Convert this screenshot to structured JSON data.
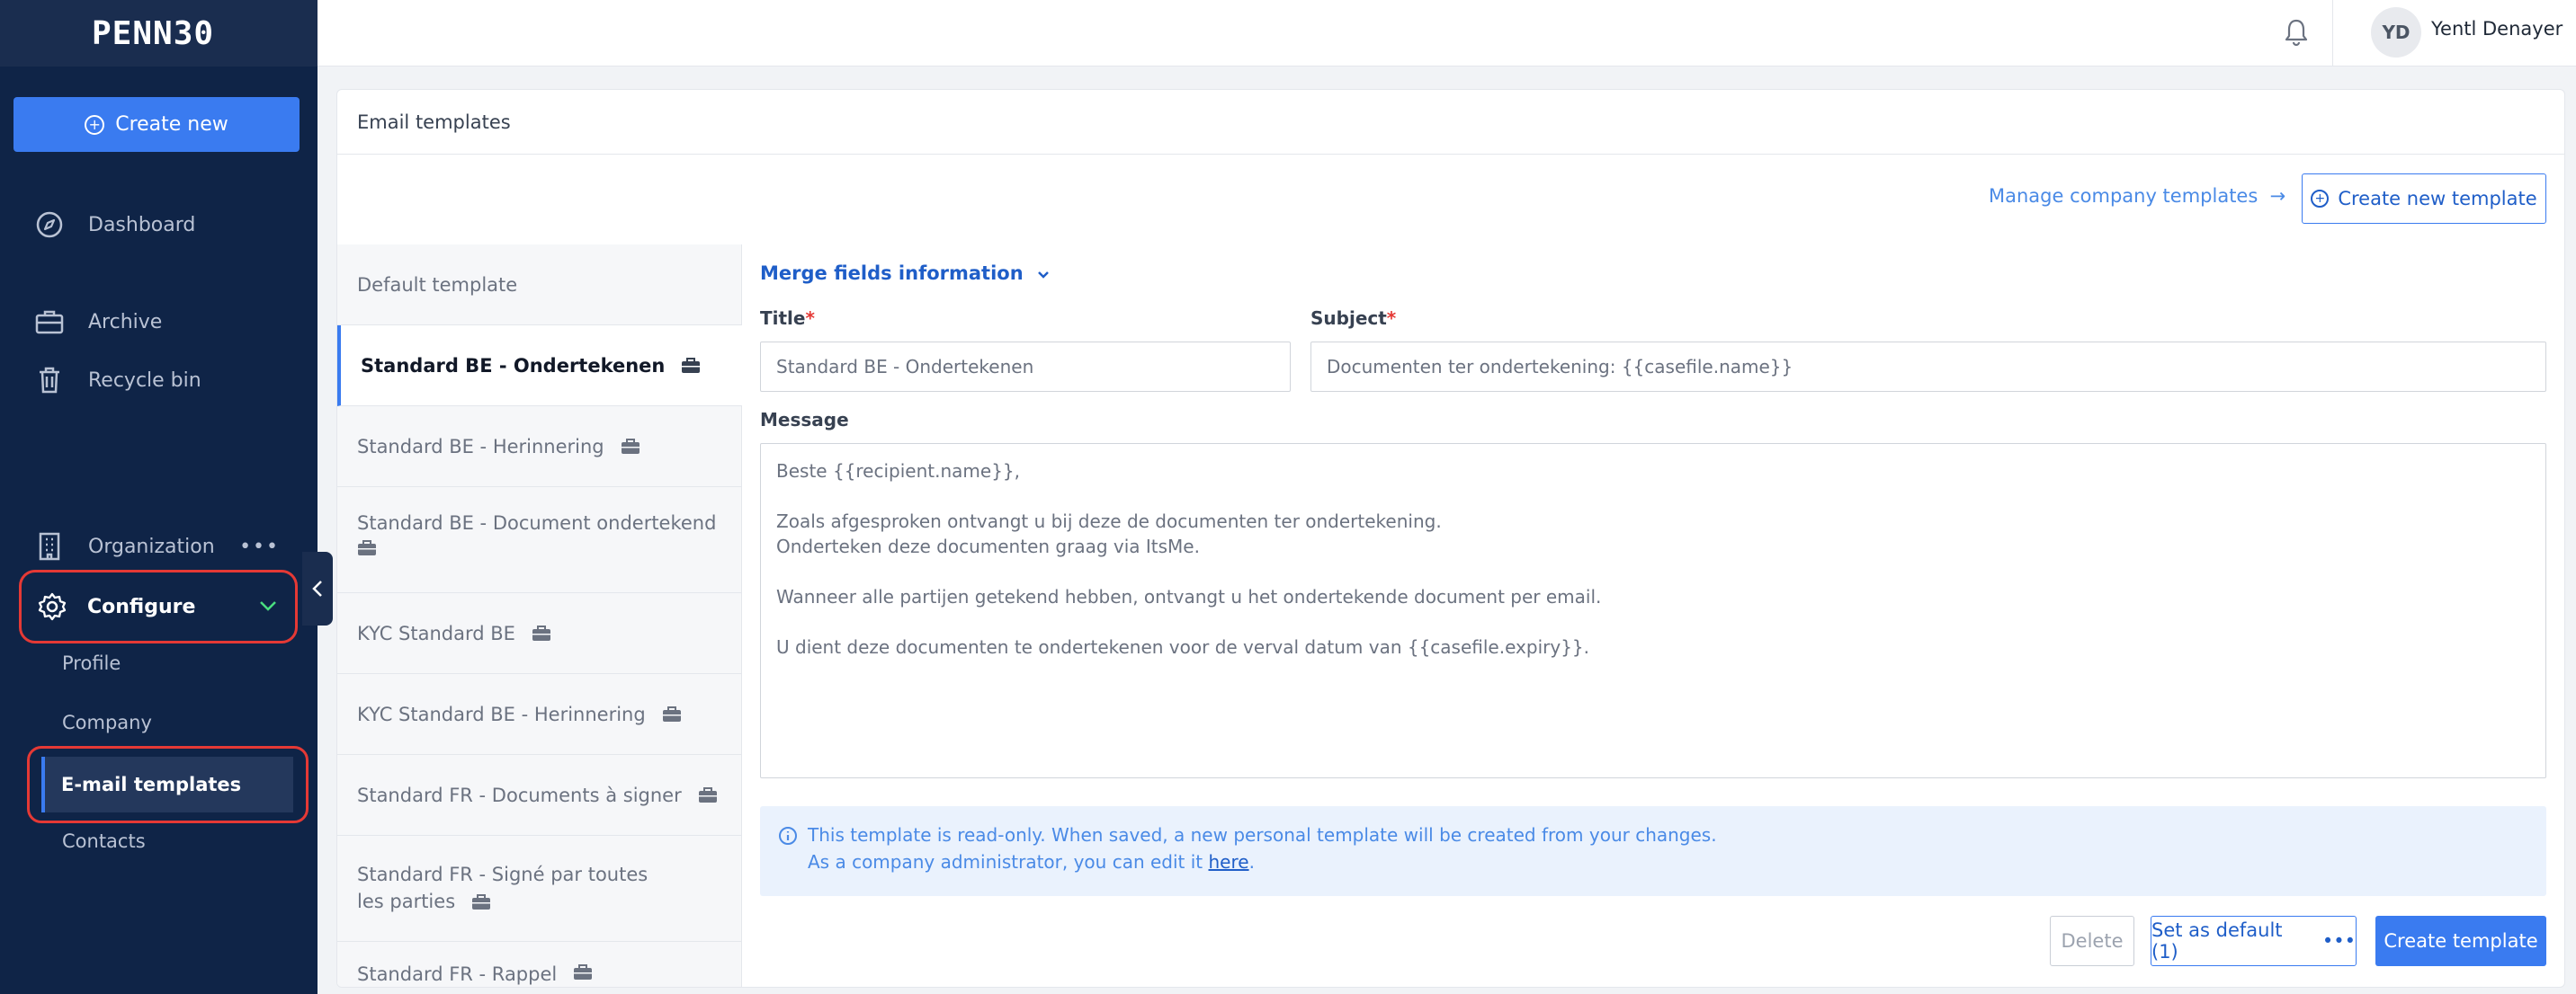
{
  "sidebar": {
    "logo": "PENN30",
    "create_new": "Create new",
    "nav": {
      "dashboard": "Dashboard",
      "archive": "Archive",
      "recycle_bin": "Recycle bin",
      "organization": "Organization",
      "configure": "Configure"
    },
    "sub": {
      "profile": "Profile",
      "company": "Company",
      "email_templates": "E-mail templates",
      "contacts": "Contacts"
    }
  },
  "topbar": {
    "avatar_initials": "YD",
    "user_name": "Yentl Denayer"
  },
  "card": {
    "title": "Email templates",
    "manage_link": "Manage company templates",
    "create_new_template": "Create new template"
  },
  "templates": [
    "Default template",
    "Standard BE - Ondertekenen",
    "Standard BE - Herinnering",
    "Standard BE - Document ondertekend",
    "KYC Standard BE",
    "KYC Standard BE - Herinnering",
    "Standard FR - Documents à signer",
    "Standard FR - Signé par toutes les parties",
    "Standard FR - Rappel"
  ],
  "form": {
    "merge_fields": "Merge fields information",
    "title_label": "Title",
    "title_value": "Standard BE -  Ondertekenen",
    "subject_label": "Subject",
    "subject_value": "Documenten ter ondertekening: {{casefile.name}}",
    "message_label": "Message",
    "message_value": "Beste {{recipient.name}},\n\nZoals afgesproken ontvangt u bij deze de documenten ter ondertekening.\nOnderteken deze documenten graag via ItsMe.\n\nWanneer alle partijen getekend hebben, ontvangt u het ondertekende document per email.\n\nU dient deze documenten te ondertekenen voor de verval datum van {{casefile.expiry}}.",
    "notice_line1": "This template is read-only. When saved, a new personal template will be created from your changes.",
    "notice_line2_prefix": "As a company administrator, you can edit it",
    "notice_link": "here",
    "notice_suffix": ".",
    "delete": "Delete",
    "set_default": "Set as default (1)",
    "create_template": "Create template"
  },
  "colors": {
    "sidebar_bg": "#0f2447",
    "primary": "#3a7bf0",
    "highlight": "#e53935"
  }
}
